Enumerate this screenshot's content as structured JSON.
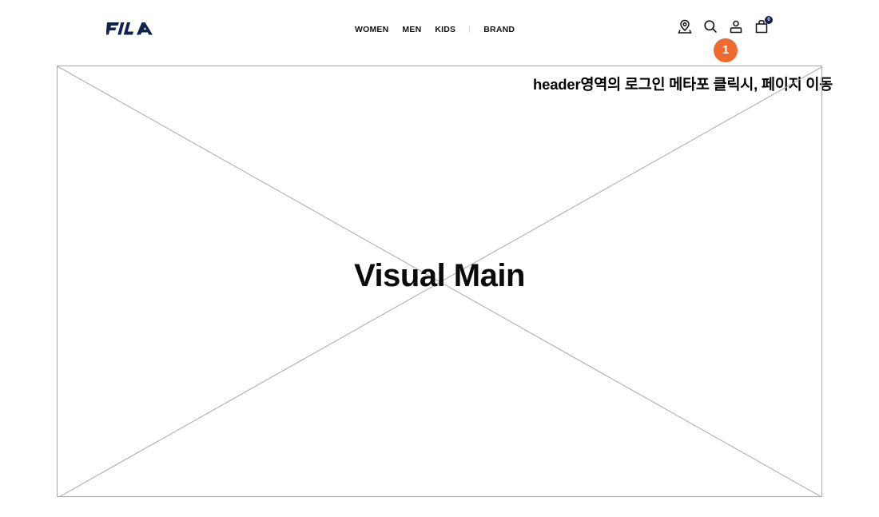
{
  "header": {
    "logo_alt": "FILA",
    "nav": {
      "women": "WOMEN",
      "men": "MEN",
      "kids": "KIDS",
      "brand": "BRAND"
    },
    "icons": [
      "store-locator-icon",
      "search-icon",
      "user-icon",
      "cart-icon"
    ],
    "cart_count": "0"
  },
  "annotation": {
    "marker_number": "1",
    "text": "header영역의 로그인 메타포 클릭시, 페이지 이동",
    "marker_color": "#ef6a2f"
  },
  "visual": {
    "label": "Visual Main"
  },
  "colors": {
    "brand_navy": "#0f2350",
    "placeholder_border": "#a9a9a9"
  }
}
